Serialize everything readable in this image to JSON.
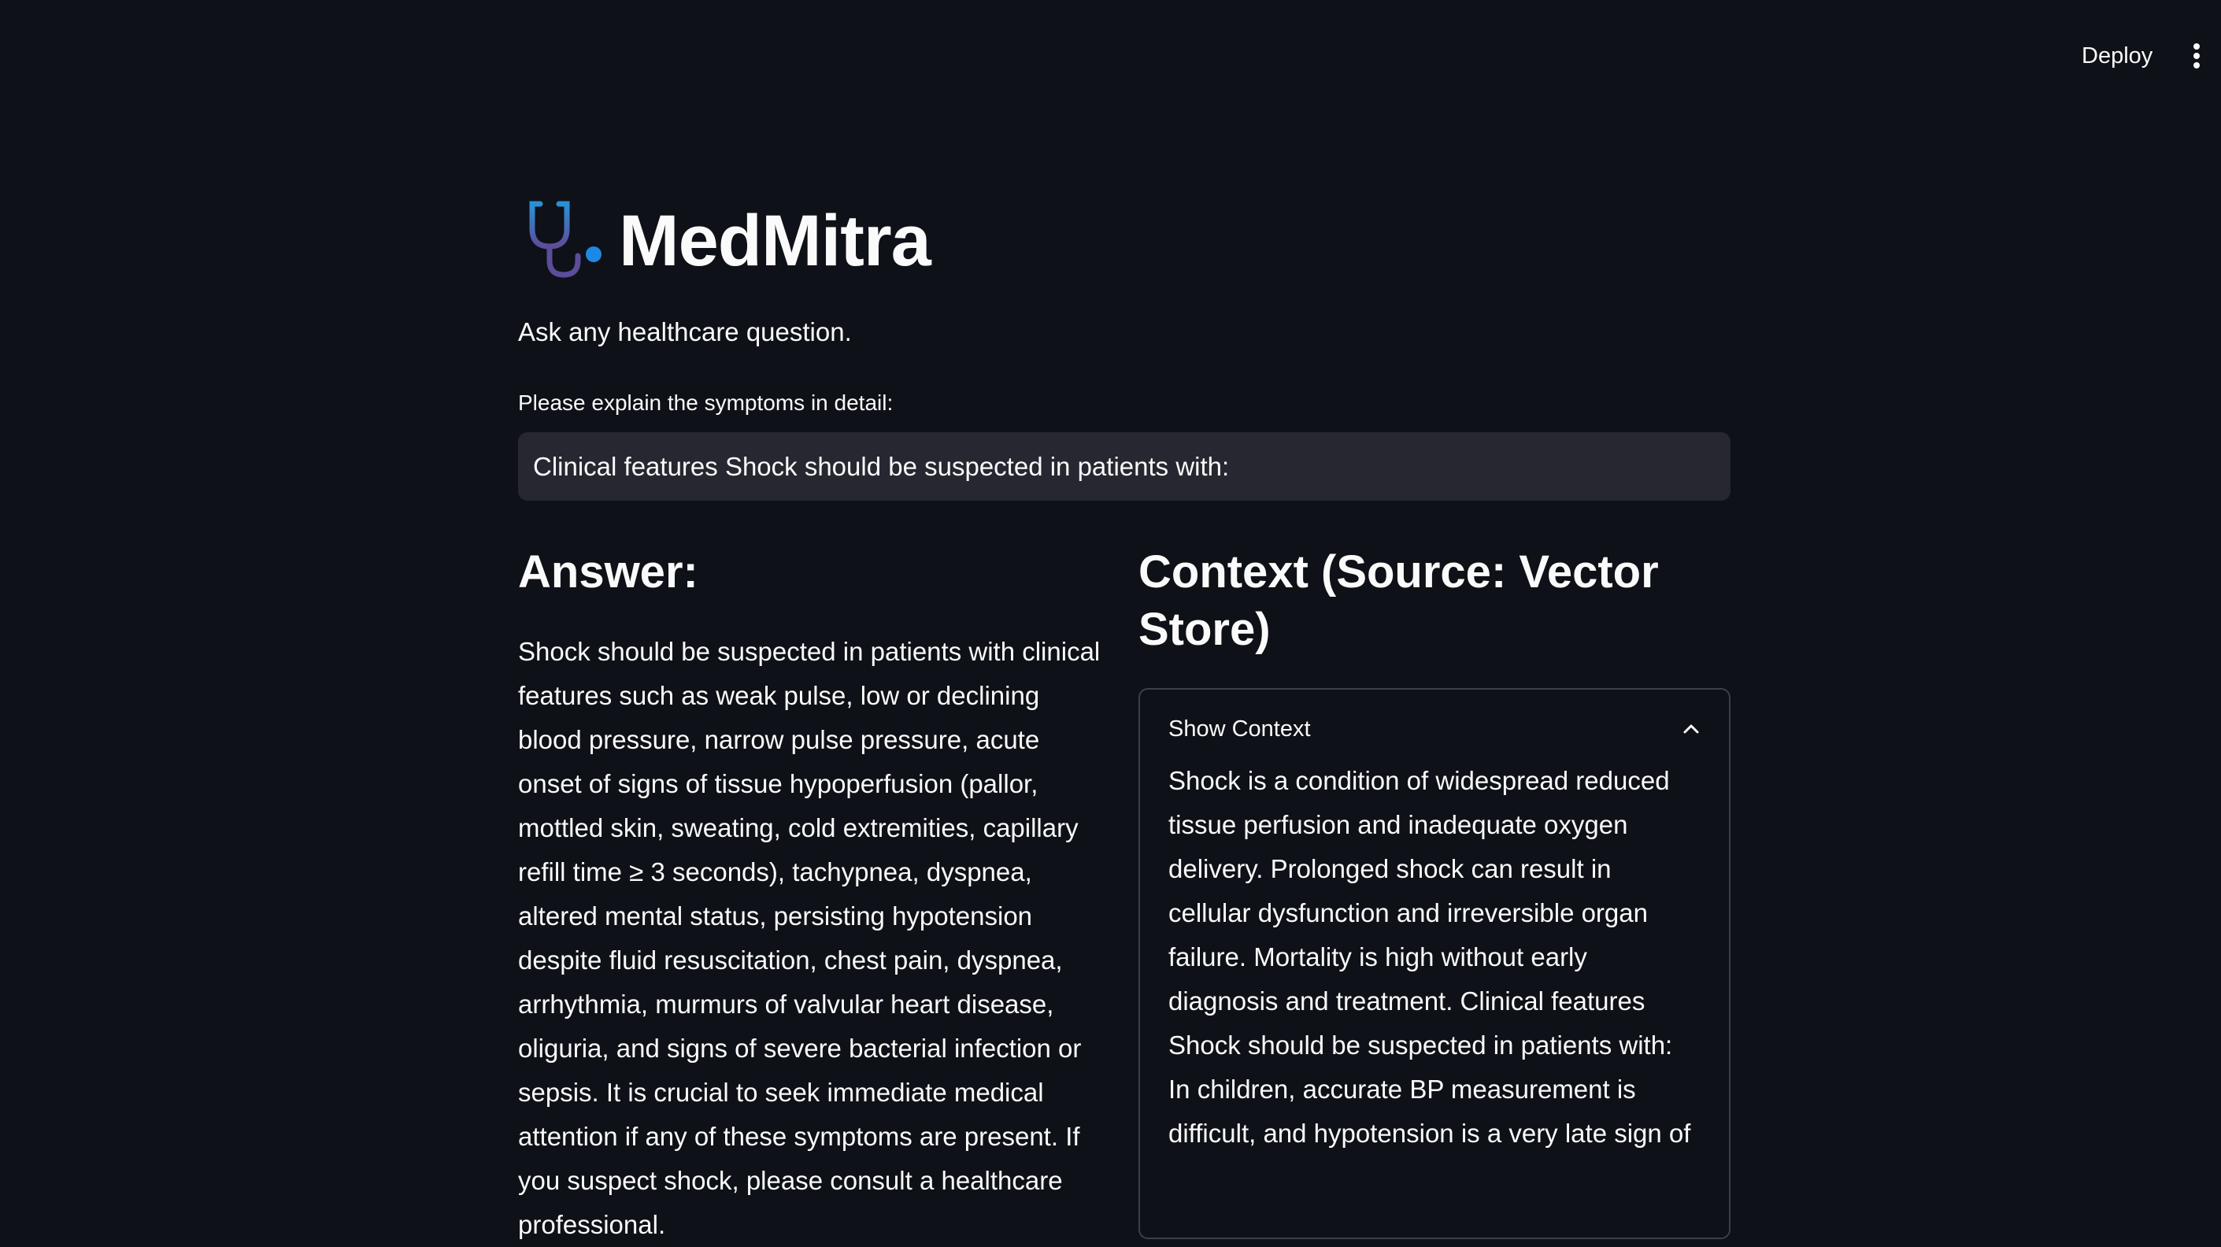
{
  "toolbar": {
    "deploy_label": "Deploy",
    "menu_icon": "vertical-ellipsis-icon"
  },
  "header": {
    "logo_icon": "stethoscope-icon",
    "title": "MedMitra",
    "subtitle": "Ask any healthcare question."
  },
  "query": {
    "label": "Please explain the symptoms in detail:",
    "value": "Clinical features Shock should be suspected in patients with:"
  },
  "answer": {
    "heading": "Answer:",
    "text": "Shock should be suspected in patients with clinical features such as weak pulse, low or declining blood pressure, narrow pulse pressure, acute onset of signs of tissue hypoperfusion (pallor, mottled skin, sweating, cold extremities, capillary refill time ≥ 3 seconds), tachypnea, dyspnea, altered mental status, persisting hypotension despite fluid resuscitation, chest pain, dyspnea, arrhythmia, murmurs of valvular heart disease, oliguria, and signs of severe bacterial infection or sepsis. It is crucial to seek immediate medical attention if any of these symptoms are present. If you suspect shock, please consult a healthcare professional."
  },
  "context": {
    "heading": "Context (Source: Vector Store)",
    "expander_label": "Show Context",
    "expander_icon": "chevron-up-icon",
    "text": "Shock is a condition of widespread reduced tissue perfusion and inadequate oxygen delivery. Prolonged shock can result in cellular dysfunction and irreversible organ failure. Mortality is high without early diagnosis and treatment. Clinical features Shock should be suspected in patients with: In children, accurate BP measurement is difficult, and hypotension is a very late sign of"
  },
  "colors": {
    "background": "#0e1117",
    "input_background": "#262730",
    "text": "#fafafa",
    "logo_accent": "#1e88e5",
    "logo_tube": "#5c4d9a"
  }
}
